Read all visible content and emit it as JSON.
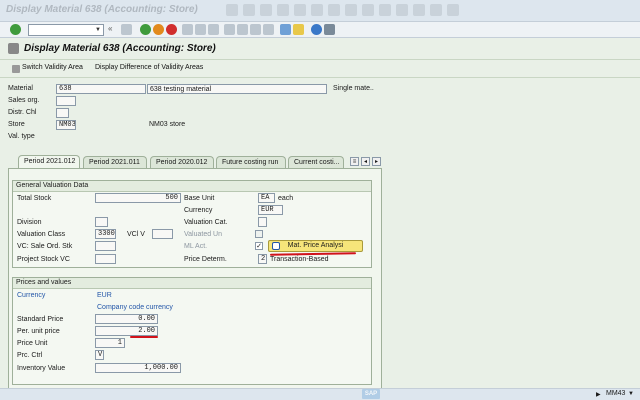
{
  "menubar": {
    "title": "Display Material 638 (Accounting: Store)"
  },
  "toolbar": {
    "command_value": ""
  },
  "titlebar": {
    "title": "Display Material 638 (Accounting: Store)"
  },
  "apptoolbar": {
    "switch_validity": "Switch Validity Area",
    "display_difference": "Display Difference of Validity Areas"
  },
  "header": {
    "material_label": "Material",
    "material_value": "638",
    "material_desc": "638 testing material",
    "single_mat": "Single mate..",
    "salesorg_label": "Sales org.",
    "distrchl_label": "Distr. Chl",
    "store_label": "Store",
    "store_value": "NM03",
    "store_desc": "NM03 store",
    "valtype_label": "Val. type"
  },
  "tabs": [
    {
      "label": "Period 2021.012"
    },
    {
      "label": "Period 2021.011"
    },
    {
      "label": "Period 2020.012"
    },
    {
      "label": "Future costing run"
    },
    {
      "label": "Current costi..."
    }
  ],
  "general": {
    "header": "General Valuation Data",
    "total_stock_label": "Total Stock",
    "total_stock_value": "500",
    "base_unit_label": "Base Unit",
    "base_unit_value": "EA",
    "base_unit_desc": "each",
    "currency_label": "Currency",
    "currency_value": "EUR",
    "division_label": "Division",
    "valuation_cat_label": "Valuation Cat.",
    "valuation_class_label": "Valuation Class",
    "valuation_class_value": "3300",
    "vcl_v_label": "VCl V",
    "valuated_un_label": "Valuated Un",
    "vc_sale_label": "VC: Sale Ord. Stk",
    "ml_act_label": "ML Act.",
    "ml_act_checked": "✓",
    "mat_price_button": "Mat. Price Analysi",
    "project_stock_label": "Project Stock VC",
    "price_determ_label": "Price Determ.",
    "price_determ_value": "2",
    "price_determ_desc": "Transaction-Based"
  },
  "prices": {
    "header": "Prices and values",
    "currency_label": "Currency",
    "currency_value": "EUR",
    "company_code_currency": "Company code currency",
    "standard_price_label": "Standard Price",
    "standard_price_value": "0.00",
    "per_unit_price_label": "Per. unit price",
    "per_unit_price_value": "2.00",
    "price_unit_label": "Price Unit",
    "price_unit_value": "1",
    "prc_ctrl_label": "Prc. Ctrl",
    "prc_ctrl_value": "V",
    "inventory_value_label": "Inventory Value",
    "inventory_value_value": "1,000.00"
  },
  "statusbar": {
    "sap_logo": "SAP",
    "system": "MM43"
  },
  "colors": {
    "accent_underline": "#d1121b",
    "button_yellow": "#f6e57a"
  }
}
